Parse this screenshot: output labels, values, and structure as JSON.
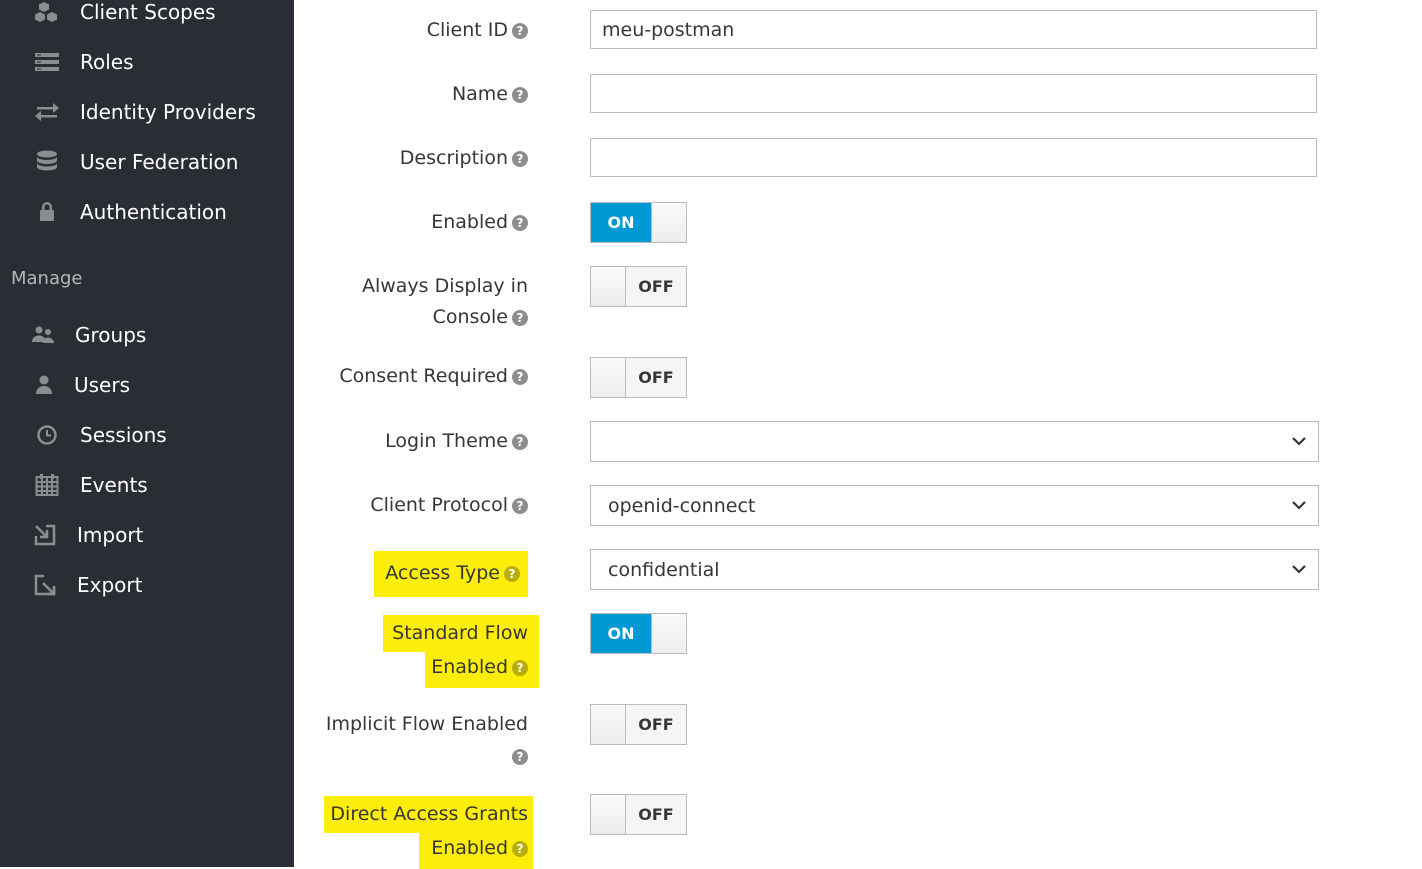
{
  "sidebar": {
    "configure_items": [
      {
        "label": "Client Scopes",
        "icon": "cubes-icon"
      },
      {
        "label": "Roles",
        "icon": "roles-icon"
      },
      {
        "label": "Identity Providers",
        "icon": "exchange-icon"
      },
      {
        "label": "User Federation",
        "icon": "database-icon"
      },
      {
        "label": "Authentication",
        "icon": "lock-icon"
      }
    ],
    "manage_title": "Manage",
    "manage_items": [
      {
        "label": "Groups",
        "icon": "users-icon"
      },
      {
        "label": "Users",
        "icon": "user-icon"
      },
      {
        "label": "Sessions",
        "icon": "clock-icon"
      },
      {
        "label": "Events",
        "icon": "calendar-icon"
      },
      {
        "label": "Import",
        "icon": "import-icon"
      },
      {
        "label": "Export",
        "icon": "export-icon"
      }
    ]
  },
  "form": {
    "help_glyph": "?",
    "client_id": {
      "label": "Client ID",
      "value": "meu-postman"
    },
    "name": {
      "label": "Name",
      "value": ""
    },
    "description": {
      "label": "Description",
      "value": ""
    },
    "enabled": {
      "label": "Enabled",
      "state": "ON"
    },
    "always_display": {
      "label_line1": "Always Display in",
      "label_line2": "Console",
      "state": "OFF"
    },
    "consent_required": {
      "label": "Consent Required",
      "state": "OFF"
    },
    "login_theme": {
      "label": "Login Theme",
      "value": ""
    },
    "client_protocol": {
      "label": "Client Protocol",
      "value": "openid-connect"
    },
    "access_type": {
      "label": "Access Type",
      "value": "confidential"
    },
    "standard_flow": {
      "label_line1": "Standard Flow",
      "label_line2": "Enabled",
      "state": "ON"
    },
    "implicit_flow": {
      "label_line1": "Implicit Flow Enabled",
      "state": "OFF"
    },
    "direct_access": {
      "label_line1": "Direct Access Grants",
      "label_line2": "Enabled",
      "state": "OFF"
    }
  },
  "colors": {
    "sidebar_bg": "#292e34",
    "toggle_on": "#0099d3",
    "highlight": "#fcee0a"
  }
}
